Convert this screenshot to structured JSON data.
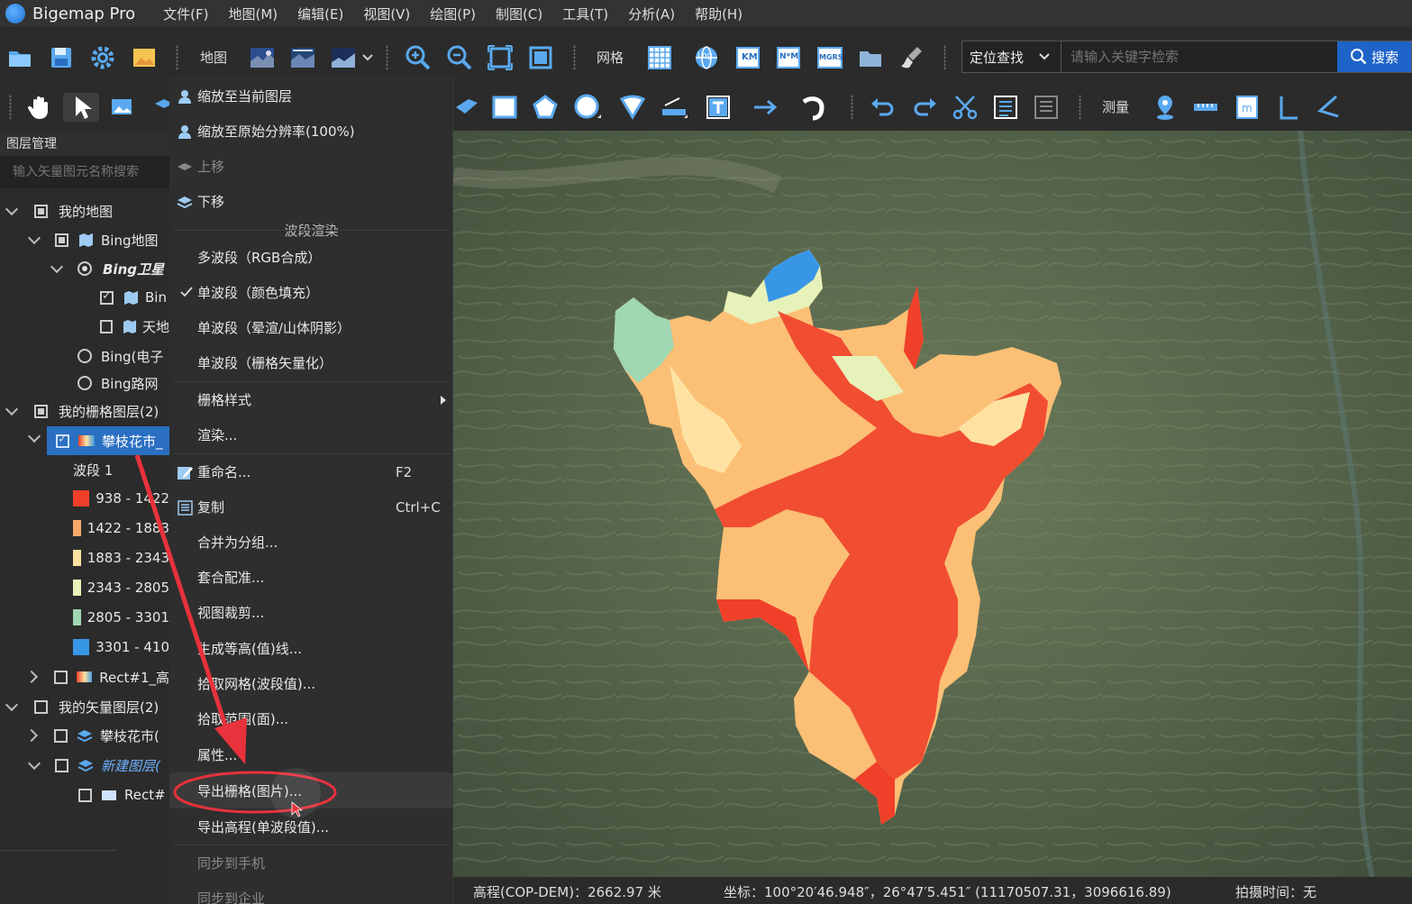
{
  "app": {
    "title": "Bigemap Pro"
  },
  "menubar": {
    "items": [
      "文件(F)",
      "地图(M)",
      "编辑(E)",
      "视图(V)",
      "绘图(P)",
      "制图(C)",
      "工具(T)",
      "分析(A)",
      "帮助(H)"
    ]
  },
  "toolbar": {
    "map_label": "地图",
    "grid_label": "网格",
    "measure_label": "测量",
    "grid_icons": [
      "Lng",
      "KM",
      "N*M",
      "MGRS"
    ]
  },
  "search": {
    "type_label": "定位查找",
    "placeholder": "请输入关键字检索",
    "button_label": "搜索"
  },
  "layer_panel": {
    "header": "图层管理",
    "search_placeholder": "输入矢量图元名称搜索",
    "rows": [
      "我的地图",
      "Bing地图",
      "Bing卫星",
      "Bin",
      "天地",
      "Bing(电子",
      "Bing路网",
      "我的栅格图层(2)",
      "攀枝花市_",
      "波段 1",
      "938 - 1422",
      "1422 - 1883",
      "1883 - 2343",
      "2343 - 2805",
      "2805 - 3301",
      "3301 - 410",
      "Rect#1_高",
      "我的矢量图层(2)",
      "攀枝花市(",
      "新建图层(",
      "Rect#"
    ],
    "legend_colors": [
      "#f0402a",
      "#f9a968",
      "#fde2a1",
      "#e6f2b9",
      "#9fd7b3",
      "#3896e6"
    ]
  },
  "context_menu": {
    "items": {
      "zoom_current": "缩放至当前图层",
      "zoom_native": "缩放至原始分辨率(100%)",
      "move_up": "上移",
      "move_down": "下移",
      "band_section": "波段渲染",
      "multi_band": "多波段（RGB合成）",
      "single_color": "单波段（颜色填充）",
      "single_shade": "单波段（晕渲/山体阴影）",
      "single_vector": "单波段（栅格矢量化）",
      "raster_style": "栅格样式",
      "render": "渲染...",
      "rename": "重命名...",
      "rename_shortcut": "F2",
      "copy": "复制",
      "copy_shortcut": "Ctrl+C",
      "merge_group": "合并为分组...",
      "register": "套合配准...",
      "view_clip": "视图裁剪...",
      "contour": "生成等高(值)线...",
      "pick_grid": "拾取网格(波段值)...",
      "pick_range": "拾取范围(面)...",
      "properties": "属性...",
      "export_raster": "导出栅格(图片)...",
      "export_elevation": "导出高程(单波段值)...",
      "sync_phone": "同步到手机",
      "sync_enterprise": "同步到企业"
    }
  },
  "statusbar": {
    "elevation": "高程(COP-DEM)：2662.97 米",
    "coords": "坐标：100°20′46.948″，26°47′5.451″   (11170507.31，3096616.89)",
    "shot_time": "拍摄时间：无"
  },
  "colors": {
    "accent": "#2a6fc2",
    "highlight_ring": "#e8323c"
  }
}
